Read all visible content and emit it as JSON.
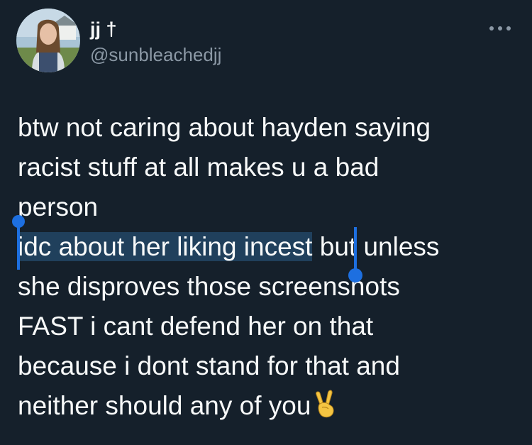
{
  "author": {
    "display_name": "jj †",
    "handle": "@sunbleachedjj",
    "avatar": "profile-photo"
  },
  "tweet": {
    "lines": [
      "btw not caring about hayden saying",
      "racist stuff at all makes u a bad",
      "person"
    ],
    "selected_text": "idc about her liking incest",
    "after_selection": " but unless",
    "continued_lines": [
      "she disproves those screenshots",
      "FAST i cant defend her on that",
      "because i dont stand for that and",
      "neither should any of you"
    ],
    "emoji": "victory-hand-emoji"
  },
  "more_menu_icon": "more-horizontal-icon",
  "colors": {
    "background": "#15202b",
    "text": "#f7f9f9",
    "secondary_text": "#8b98a5",
    "selection": "#20405c",
    "selection_handle": "#1d6fe0"
  }
}
